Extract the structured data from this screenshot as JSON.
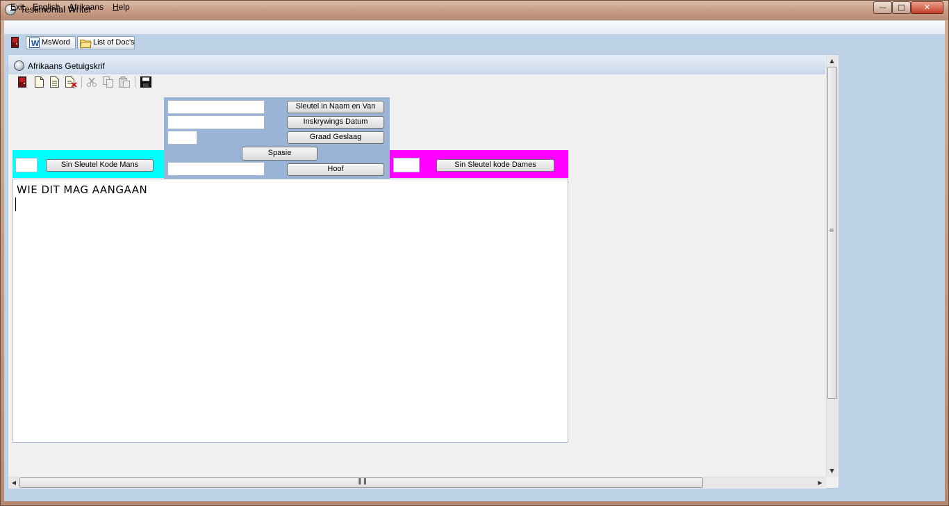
{
  "window": {
    "title": "Testimonial Writer"
  },
  "menu": [
    {
      "label": "Exit",
      "underline": "E",
      "rest": "xit"
    },
    {
      "label": "English",
      "underline": "E",
      "rest": "nglish"
    },
    {
      "label": "Afrikaans",
      "underline": "A",
      "rest": "frikaans"
    },
    {
      "label": "Help",
      "underline": "H",
      "rest": "elp"
    }
  ],
  "toolbar": {
    "msword_label": "MsWord",
    "docs_label": "List of Doc's"
  },
  "child": {
    "title": "Afrikaans Getuigskrif"
  },
  "center": {
    "btn_name": "Sleutel in Naam en Van",
    "btn_date": "Inskrywings Datum",
    "btn_grade": "Graad Geslaag",
    "btn_space": "Spasie",
    "btn_head": "Hoof",
    "field_name": "",
    "field_date": "",
    "field_grade": "",
    "field_head": ""
  },
  "male": {
    "button": "Sin Sleutel Kode Mans",
    "code": ""
  },
  "female": {
    "button": "Sin Sleutel kode Dames",
    "code": ""
  },
  "editor": {
    "text": "WIE DIT MAG AANGAAN"
  },
  "colors": {
    "male_panel": "#00ffff",
    "female_panel": "#ff00ff",
    "center_panel": "#9ab4d7"
  }
}
